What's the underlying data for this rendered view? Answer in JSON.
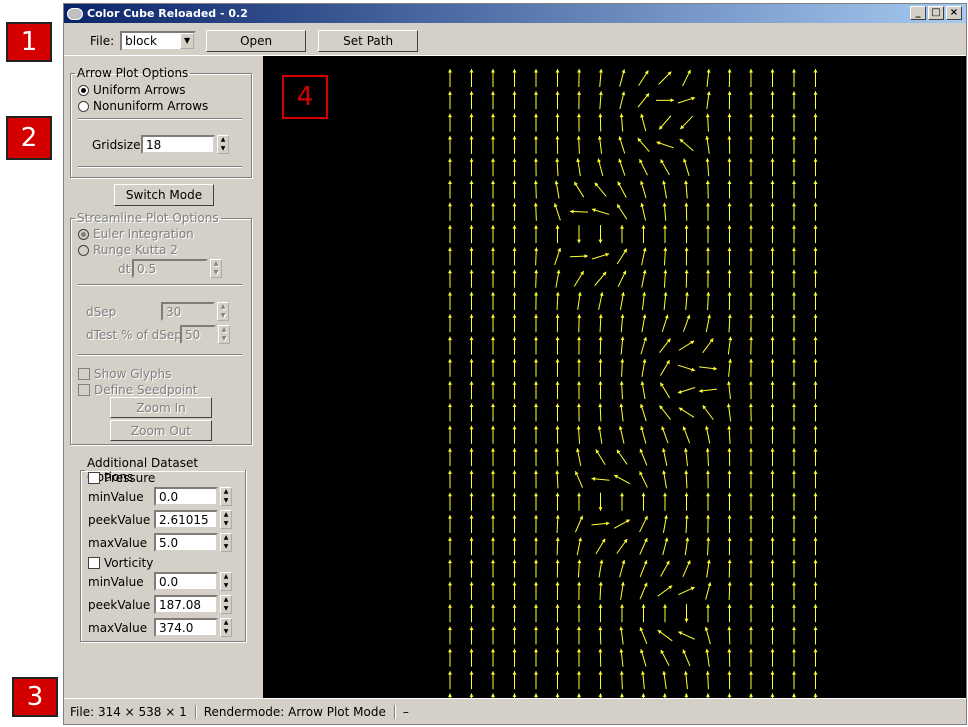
{
  "markers": {
    "m1": "1",
    "m2": "2",
    "m3": "3",
    "m4": "4"
  },
  "window": {
    "title": "Color Cube Reloaded - 0.2",
    "minimize": "_",
    "maximize": "□",
    "close": "×"
  },
  "toolbar": {
    "file_label": "File:",
    "file_value": "block",
    "open_label": "Open",
    "setpath_label": "Set Path"
  },
  "arrow_options": {
    "legend": "Arrow Plot Options",
    "uniform": "Uniform Arrows",
    "nonuniform": "Nonuniform Arrows",
    "gridsize_label": "Gridsize",
    "gridsize_value": "18"
  },
  "switch_mode_label": "Switch Mode",
  "streamline_options": {
    "legend": "Streamline Plot Options",
    "euler": "Euler Integration",
    "runge": "Runge Kutta 2",
    "dt_label": "dt",
    "dt_value": "0.5",
    "dsep_label": "dSep",
    "dsep_value": "30",
    "dtest_label": "dTest % of dSep",
    "dtest_value": "50",
    "show_glyphs": "Show Glyphs",
    "define_seedpoint": "Define Seedpoint",
    "zoom_in": "Zoom In",
    "zoom_out": "Zoom Out"
  },
  "dataset_options": {
    "legend": "Additional Dataset Options",
    "pressure": "Pressure",
    "p_min_label": "minValue",
    "p_min": "0.0",
    "p_peek_label": "peekValue",
    "p_peek": "2.61015",
    "p_max_label": "maxValue",
    "p_max": "5.0",
    "vorticity": "Vorticity",
    "v_min_label": "minValue",
    "v_min": "0.0",
    "v_peek_label": "peekValue",
    "v_peek": "187.08",
    "v_max_label": "maxValue",
    "v_max": "374.0"
  },
  "status": {
    "file": "File: 314 × 538 × 1",
    "mode": "Rendermode: Arrow Plot Mode",
    "extra": "–"
  },
  "colors": {
    "arrow": "#ffff33",
    "canvas_bg": "#000000",
    "title_start": "#0a246a",
    "marker": "#d40000"
  },
  "arrow_field": {
    "gridsize": 18,
    "columns": 18,
    "rows": 30,
    "vortices": [
      {
        "cx": 9.5,
        "cy": 1.8,
        "strength": 4.0
      },
      {
        "cx": 7.2,
        "cy": 7.0,
        "strength": -4.5
      },
      {
        "cx": 10.5,
        "cy": 13.5,
        "strength": 4.0
      },
      {
        "cx": 8.0,
        "cy": 19.0,
        "strength": -4.0
      },
      {
        "cx": 10.0,
        "cy": 24.0,
        "strength": 3.0
      }
    ]
  }
}
